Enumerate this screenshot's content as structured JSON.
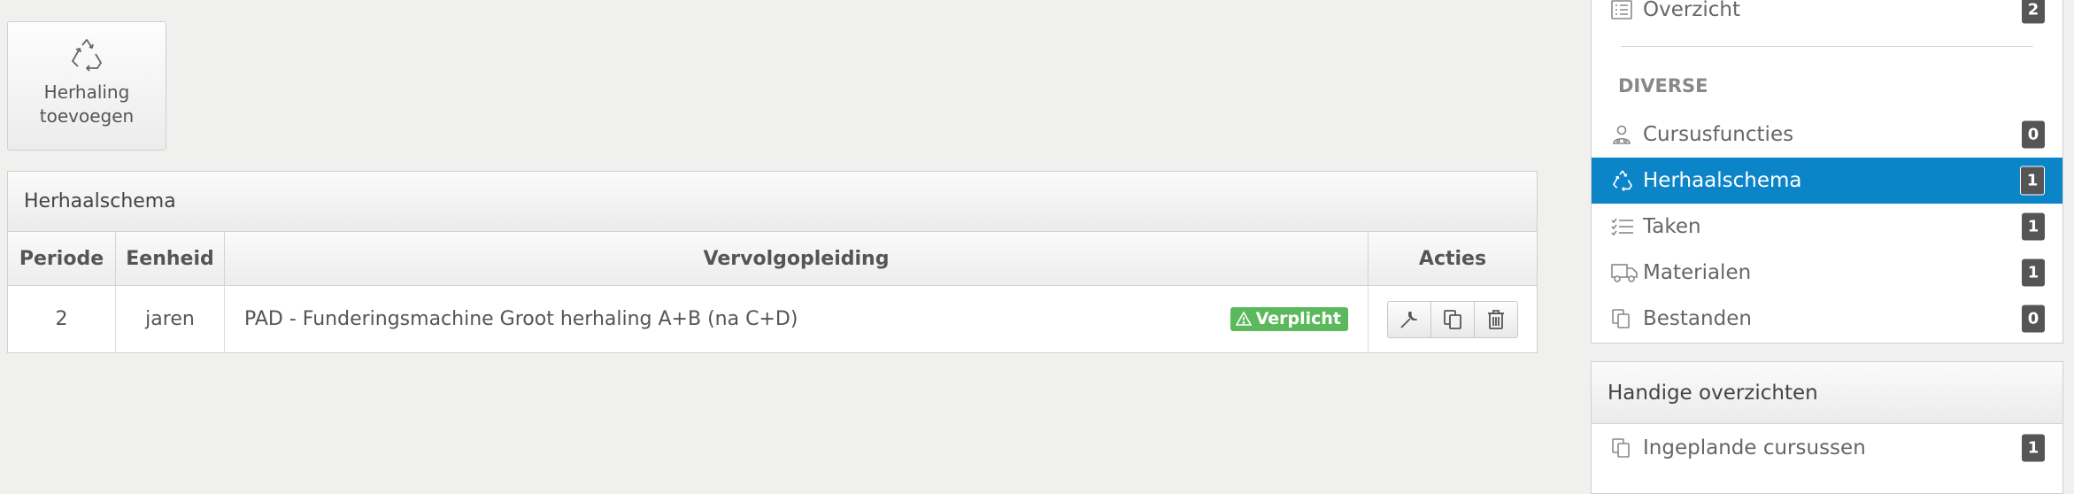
{
  "add_button": {
    "label_line1": "Herhaling",
    "label_line2": "toevoegen",
    "icon": "recycle-icon"
  },
  "panel": {
    "title": "Herhaalschema",
    "columns": [
      "Periode",
      "Eenheid",
      "Vervolgopleiding",
      "Acties"
    ],
    "rows": [
      {
        "period": "2",
        "unit": "jaren",
        "course": "PAD - Funderingsmachine Groot herhaling A+B (na C+D)",
        "badge": "Verplicht"
      }
    ],
    "actions": [
      "wrench-icon",
      "copy-icon",
      "trash-icon"
    ]
  },
  "sidebar": {
    "top_item": {
      "label": "Overzicht",
      "count": "2",
      "icon": "list-icon"
    },
    "section_title": "DIVERSE",
    "items": [
      {
        "label": "Cursusfuncties",
        "count": "0",
        "icon": "user-icon",
        "active": false
      },
      {
        "label": "Herhaalschema",
        "count": "1",
        "icon": "recycle-icon",
        "active": true
      },
      {
        "label": "Taken",
        "count": "1",
        "icon": "tasks-icon",
        "active": false
      },
      {
        "label": "Materialen",
        "count": "1",
        "icon": "truck-icon",
        "active": false
      },
      {
        "label": "Bestanden",
        "count": "0",
        "icon": "files-icon",
        "active": false
      }
    ],
    "active_color": "#0c84c8"
  },
  "handy": {
    "title": "Handige overzichten",
    "items": [
      {
        "label": "Ingeplande cursussen",
        "count": "1",
        "icon": "files-icon"
      }
    ]
  },
  "colors": {
    "badge": "#5cb85c",
    "count_badge": "#555555"
  }
}
